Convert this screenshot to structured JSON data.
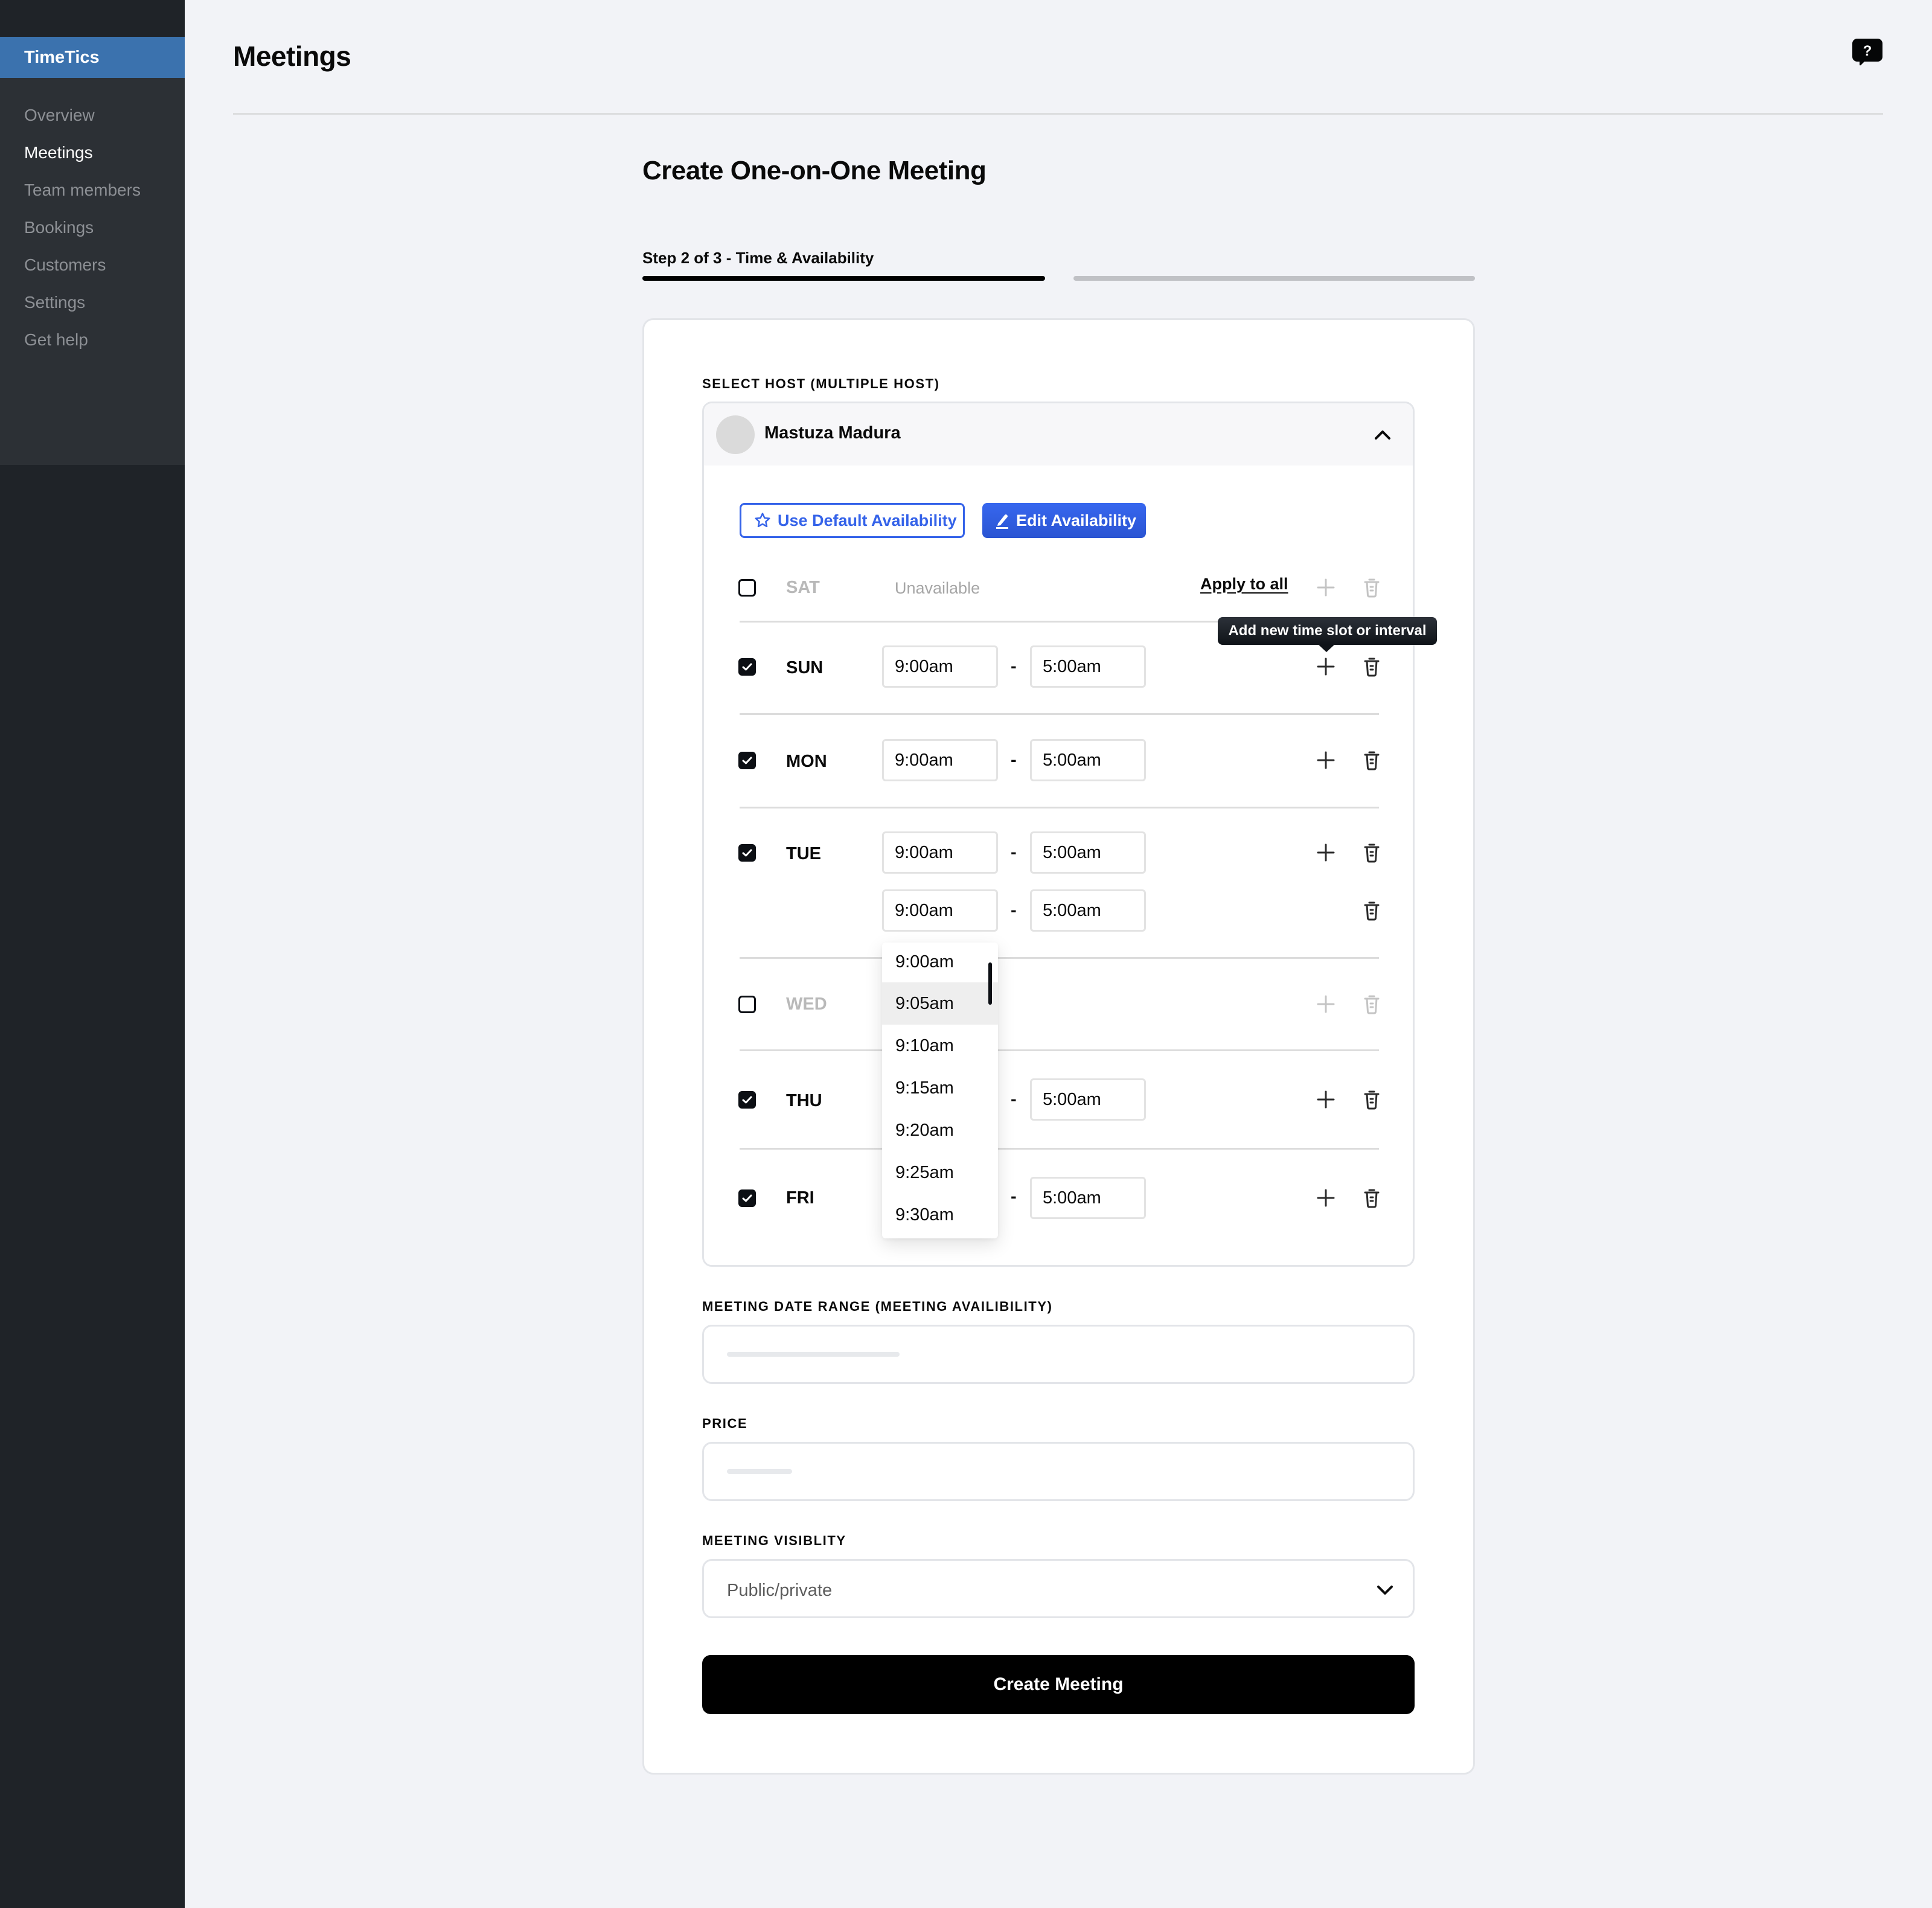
{
  "app": {
    "brand": "TimeTics"
  },
  "sidebar": {
    "items": [
      {
        "label": "Overview",
        "active": false
      },
      {
        "label": "Meetings",
        "active": true
      },
      {
        "label": "Team members",
        "active": false
      },
      {
        "label": "Bookings",
        "active": false
      },
      {
        "label": "Customers",
        "active": false
      },
      {
        "label": "Settings",
        "active": false
      },
      {
        "label": "Get help",
        "active": false
      }
    ]
  },
  "header": {
    "title": "Meetings",
    "help_icon": "help-chat-icon"
  },
  "form": {
    "title": "Create One-on-One Meeting",
    "step": {
      "label": "Step 2 of 3 - Time & Availability",
      "current": 2,
      "total": 3
    },
    "host": {
      "label": "SELECT HOST (MULTIPLE HOST)",
      "name": "Mastuza Madura",
      "expanded": true,
      "use_default_label": "Use Default Availability",
      "edit_label": "Edit Availability"
    },
    "availability": {
      "apply_all_label": "Apply to all",
      "unavailable_label": "Unavailable",
      "dash": "-",
      "tooltip": "Add new time slot or interval",
      "days": [
        {
          "day": "SAT",
          "enabled": false,
          "slots": []
        },
        {
          "day": "SUN",
          "enabled": true,
          "slots": [
            {
              "start": "9:00am",
              "end": "5:00am"
            }
          ]
        },
        {
          "day": "MON",
          "enabled": true,
          "slots": [
            {
              "start": "9:00am",
              "end": "5:00am"
            }
          ]
        },
        {
          "day": "TUE",
          "enabled": true,
          "slots": [
            {
              "start": "9:00am",
              "end": "5:00am"
            },
            {
              "start": "9:00am",
              "end": "5:00am"
            }
          ]
        },
        {
          "day": "WED",
          "enabled": false,
          "slots": []
        },
        {
          "day": "THU",
          "enabled": true,
          "slots": [
            {
              "start": "9:00am",
              "end": "5:00am"
            }
          ]
        },
        {
          "day": "FRI",
          "enabled": true,
          "slots": [
            {
              "start": "9:00am",
              "end": "5:00am"
            }
          ]
        }
      ],
      "time_dropdown": {
        "options": [
          "9:00am",
          "9:05am",
          "9:10am",
          "9:15am",
          "9:20am",
          "9:25am",
          "9:30am"
        ],
        "highlighted": "9:05am"
      }
    },
    "date_range": {
      "label": "MEETING DATE RANGE (MEETING AVAILIBILITY)",
      "value": ""
    },
    "price": {
      "label": "PRICE",
      "value": ""
    },
    "visibility": {
      "label": "MEETING VISIBLITY",
      "placeholder": "Public/private"
    },
    "submit_label": "Create Meeting"
  },
  "colors": {
    "brand": "#3b72ae",
    "accent": "#3563e9",
    "sidebar_bg": "#2c3035",
    "page_bg": "#f2f3f7"
  }
}
